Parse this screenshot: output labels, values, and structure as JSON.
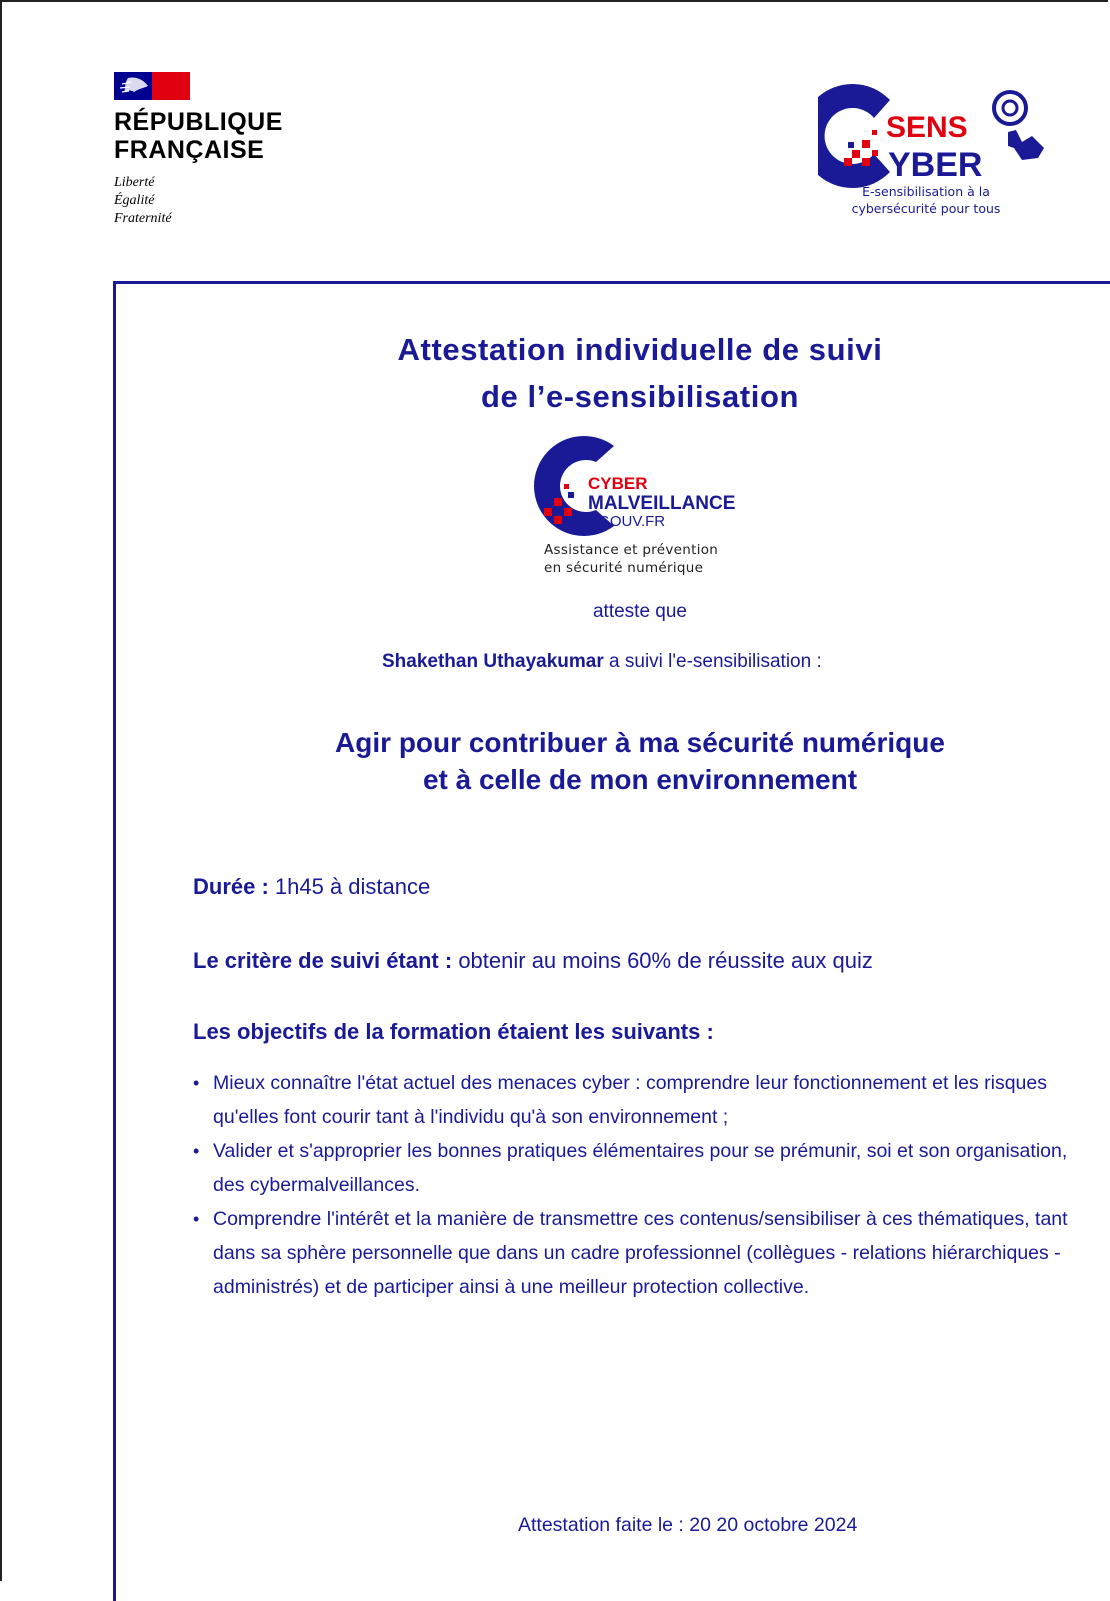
{
  "header": {
    "rf_name_line1": "RÉPUBLIQUE",
    "rf_name_line2": "FRANÇAISE",
    "rf_motto": [
      "Liberté",
      "Égalité",
      "Fraternité"
    ],
    "sens_logo_word1": "SENS",
    "sens_logo_word2": "YBER",
    "sens_tagline_line1": "E-sensibilisation à la",
    "sens_tagline_line2": "cybersécurité pour tous"
  },
  "title": {
    "line1": "Attestation individuelle de suivi",
    "line2": "de l’e-sensibilisation"
  },
  "cm_logo": {
    "word1": "CYBER",
    "word2": "MALVEILLANCE",
    "word3": ".GOUV.FR",
    "tagline_line1": "Assistance et prévention",
    "tagline_line2": "en sécurité numérique"
  },
  "attest": {
    "atteste": "atteste que",
    "person_name": "Shakethan Uthayakumar",
    "suivi_text": " a suivi l'e-sensibilisation :"
  },
  "course": {
    "line1": "Agir pour contribuer à ma sécurité numérique",
    "line2": "et à celle de mon environnement"
  },
  "details": {
    "duree_label": "Durée :",
    "duree_value": " 1h45 à distance",
    "critere_label": "Le critère de suivi étant :",
    "critere_value": " obtenir au moins 60% de réussite aux quiz",
    "objectifs_heading": "Les objectifs de la formation étaient les suivants :"
  },
  "objectives": [
    "Mieux connaître l'état actuel des menaces cyber : comprendre leur fonctionnement et les risques qu'elles font courir tant à l'individu qu'à son environnement ;",
    "Valider et s'approprier les bonnes pratiques élémentaires pour se prémunir, soi et son organisation, des cybermalveillances.",
    "Comprendre l'intérêt et la manière de transmettre ces contenus/sensibiliser à ces thématiques, tant dans sa sphère personnelle que dans un cadre professionnel (collègues - relations hiérarchiques - administrés) et de participer ainsi à une meilleur protection collective."
  ],
  "footer": {
    "date_text": "Attestation faite le : 20 20 octobre 2024"
  },
  "colors": {
    "navy": "#1a1a96",
    "red": "#e1000f",
    "rf_blue": "#000091"
  }
}
